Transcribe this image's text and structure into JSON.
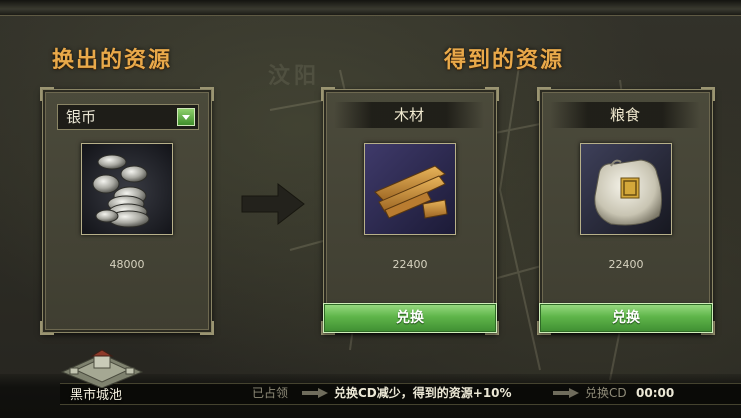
{
  "left_section": {
    "title": "换出的资源",
    "select_value": "银币",
    "amount": "48000"
  },
  "right_section": {
    "title": "得到的资源",
    "resources": [
      {
        "name": "木材",
        "amount": "22400",
        "button": "兑换"
      },
      {
        "name": "粮食",
        "amount": "22400",
        "button": "兑换"
      }
    ]
  },
  "background_place_text": "汶阳",
  "bottom_bar": {
    "city_label": "黑市城池",
    "step_occupied": "已占领",
    "step_effect": "兑换CD减少，得到的资源+10%",
    "cd_label": "兑换CD",
    "cd_time": "00:00"
  },
  "icons": [
    "silver-coins-icon",
    "wood-planks-icon",
    "grain-sack-icon",
    "right-arrow-icon",
    "dropdown-arrow-icon",
    "city-icon"
  ],
  "colors": {
    "title": "#e9a94a",
    "button_green": "#5fb54a",
    "panel": "#45443a"
  }
}
